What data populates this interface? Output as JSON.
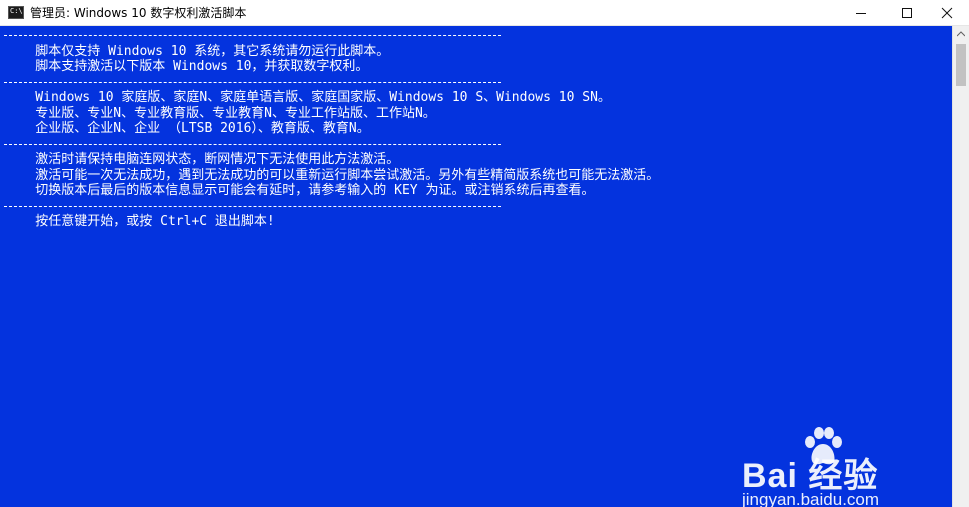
{
  "window": {
    "title": "管理员:  Windows 10 数字权利激活脚本",
    "icon_name": "cmd-icon",
    "icon_glyph": "C:\\"
  },
  "colors": {
    "console_background": "#0433de",
    "console_text": "#ffffff"
  },
  "console": {
    "lines": [
      "",
      "    脚本仅支持 Windows 10 系统，其它系统请勿运行此脚本。",
      "    脚本支持激活以下版本 Windows 10，并获取数字权利。",
      "",
      "    Windows 10 家庭版、家庭N、家庭单语言版、家庭国家版、Windows 10 S、Windows 10 SN。",
      "    专业版、专业N、专业教育版、专业教育N、专业工作站版、工作站N。",
      "    企业版、企业N、企业 （LTSB 2016）、教育版、教育N。",
      "",
      "    激活时请保持电脑连网状态，断网情况下无法使用此方法激活。",
      "    激活可能一次无法成功，遇到无法成功的可以重新运行脚本尝试激活。另外有些精简版系统也可能无法激活。",
      "    切换版本后最后的版本信息显示可能会有延时，请参考输入的 KEY 为证。或注销系统后再查看。",
      "",
      "    按任意键开始，或按 Ctrl+C 退出脚本!"
    ]
  },
  "watermark": {
    "brand": "Bai 经验",
    "url": "jingyan.baidu.com"
  }
}
